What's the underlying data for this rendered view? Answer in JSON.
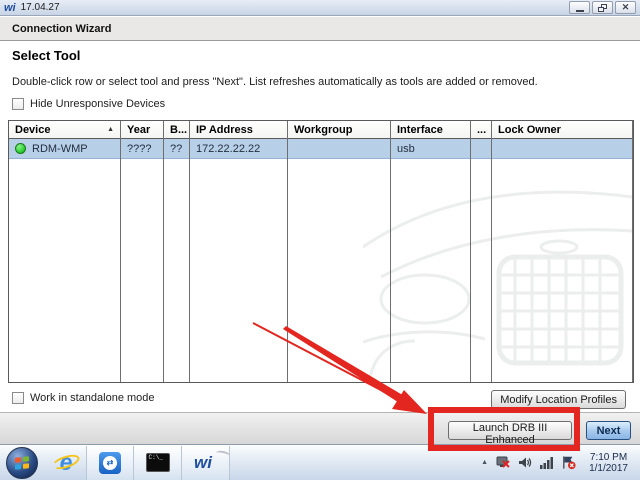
{
  "window": {
    "logo": "wi",
    "title": "17.04.27"
  },
  "wizard": {
    "header": "Connection Wizard",
    "page_title": "Select Tool",
    "instructions": "Double-click row or select tool and press \"Next\".  List refreshes automatically as tools are added or removed.",
    "hide_unresponsive_label": "Hide Unresponsive Devices",
    "standalone_label": "Work in standalone mode",
    "buttons": {
      "modify_location_profiles": "Modify Location Profiles",
      "launch_drb": "Launch DRB III Enhanced",
      "next": "Next"
    }
  },
  "table": {
    "columns": [
      "Device",
      "Year",
      "B...",
      "IP Address",
      "Workgroup",
      "Interface",
      "...",
      "Lock Owner"
    ],
    "sort_column": "Device",
    "sort_direction": "ascending",
    "rows": [
      {
        "status": "online",
        "device": "RDM-WMP",
        "year": "????",
        "b": "??",
        "ip_address": "172.22.22.22",
        "workgroup": "",
        "interface": "usb",
        "dots": "",
        "lock_owner": ""
      }
    ]
  },
  "icons": {
    "sort_asc": "▲",
    "close": "✕",
    "tray_expand": "▲",
    "ie_glyph": "e",
    "teamviewer_glyph": "⇄"
  },
  "taskbar": {
    "cmd_text": "C:\\_",
    "tray": {
      "time": "7:10 PM",
      "date": "1/1/2017"
    }
  },
  "colors": {
    "annotation_red": "#e3261f",
    "selected_row": "#b8cfe8",
    "status_online_green": "#2fd435",
    "title_logo_blue": "#1f4fa0"
  }
}
